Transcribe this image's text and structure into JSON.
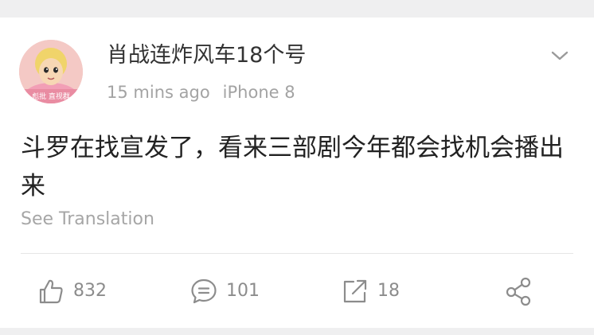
{
  "post": {
    "author": "肖战连炸风车18个号",
    "time": "15 mins ago",
    "device": "iPhone 8",
    "avatar_caption": "彪批 直视群",
    "content": "斗罗在找宣发了，看来三部剧今年都会找机会播出来",
    "translate_label": "See Translation"
  },
  "actions": {
    "likes": "832",
    "comments": "101",
    "reposts": "18"
  },
  "icons": {
    "more": "chevron-down-icon",
    "like": "thumbs-up-icon",
    "comment": "comment-bubble-icon",
    "repost": "repost-arrow-icon",
    "share": "share-icon"
  },
  "colors": {
    "text_primary": "#222222",
    "text_secondary": "#a3a3a3",
    "icon_gray": "#8c8c8c",
    "background": "#f2f2f2",
    "card": "#ffffff"
  }
}
